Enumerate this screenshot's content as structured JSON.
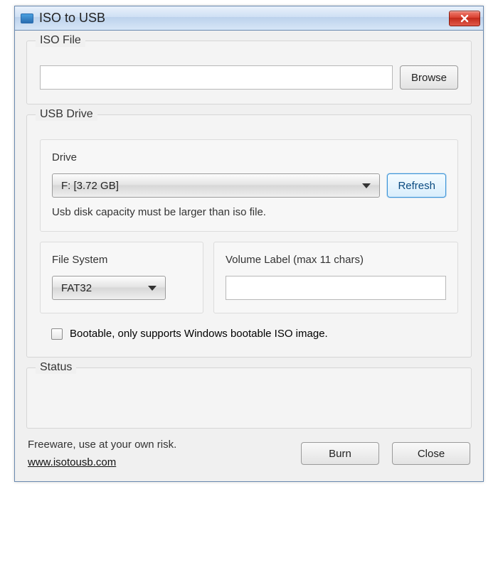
{
  "window": {
    "title": "ISO to USB"
  },
  "iso": {
    "group_label": "ISO File",
    "path_value": "",
    "browse_label": "Browse"
  },
  "usb": {
    "group_label": "USB Drive",
    "drive": {
      "label": "Drive",
      "selected": "F: [3.72 GB]",
      "refresh_label": "Refresh",
      "hint": "Usb disk capacity must be larger than iso file."
    },
    "filesystem": {
      "label": "File System",
      "selected": "FAT32"
    },
    "volume": {
      "label": "Volume Label (max 11 chars)",
      "value": ""
    },
    "bootable_label": "Bootable, only supports Windows bootable ISO image."
  },
  "status": {
    "group_label": "Status"
  },
  "footer": {
    "freeware_text": "Freeware, use at your own risk.",
    "website": "www.isotousb.com",
    "burn_label": "Burn",
    "close_label": "Close"
  }
}
